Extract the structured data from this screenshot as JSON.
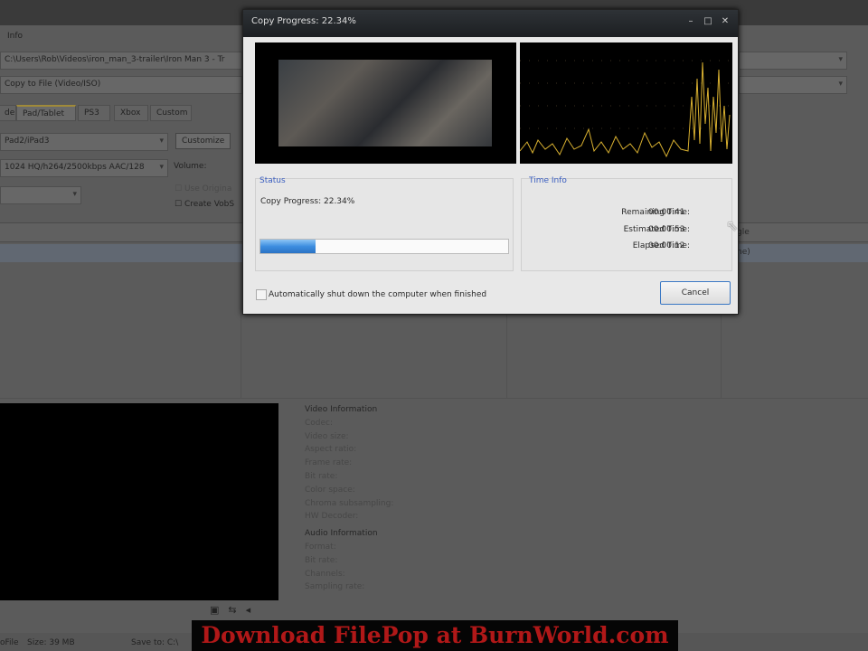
{
  "background": {
    "menu_info": "Info",
    "source_path": "C:\\Users\\Rob\\Videos\\iron_man_3-trailer\\Iron Man 3 - Tr",
    "output_mode": "Copy to File (Video/ISO)",
    "tabs": [
      "de",
      "Pad/Tablet",
      "PS3",
      "Xbox",
      "Custom"
    ],
    "active_tab": 1,
    "device": "Pad2/iPad3",
    "customize_label": "Customize",
    "profile": "1024 HQ/h264/2500kbps AAC/128",
    "volume_label": "Volume:",
    "use_original_label": "Use Origina",
    "create_label": "Create VobS",
    "right_col_header": "gle",
    "right_col_row": "ne)",
    "video_info_header": "Video Information",
    "video_info": [
      "Codec:",
      "Video size:",
      "Aspect ratio:",
      "Frame rate:",
      "Bit rate:",
      "Color space:",
      "Chroma subsampling:",
      "HW Decoder:"
    ],
    "audio_info_header": "Audio Information",
    "audio_info": [
      "Format:",
      "Bit rate:",
      "Channels:",
      "Sampling rate:"
    ],
    "status_profile": "oFile",
    "status_size": "Size: 39 MB",
    "status_save": "Save to: C:\\"
  },
  "dialog": {
    "title": "Copy Progress: 22.34%",
    "status_group": "Status",
    "progress_text": "Copy Progress: 22.34%",
    "progress_percent": 22.34,
    "time_group": "Time Info",
    "remaining_label": "Remaining Time:",
    "remaining": "00:00:41",
    "estimated_label": "Estimated Time:",
    "estimated": "00:00:53",
    "elapsed_label": "Elapsed Time:",
    "elapsed": "00:00:12",
    "shutdown_label": "Automatically shut down the computer when finished",
    "cancel_label": "Cancel"
  },
  "banner": "Download FilePop at BurnWorld.com",
  "colors": {
    "accent": "#3a5ec0",
    "progress": "#3d8ee0",
    "waveform": "#d8b030",
    "banner_text": "#b01818"
  }
}
